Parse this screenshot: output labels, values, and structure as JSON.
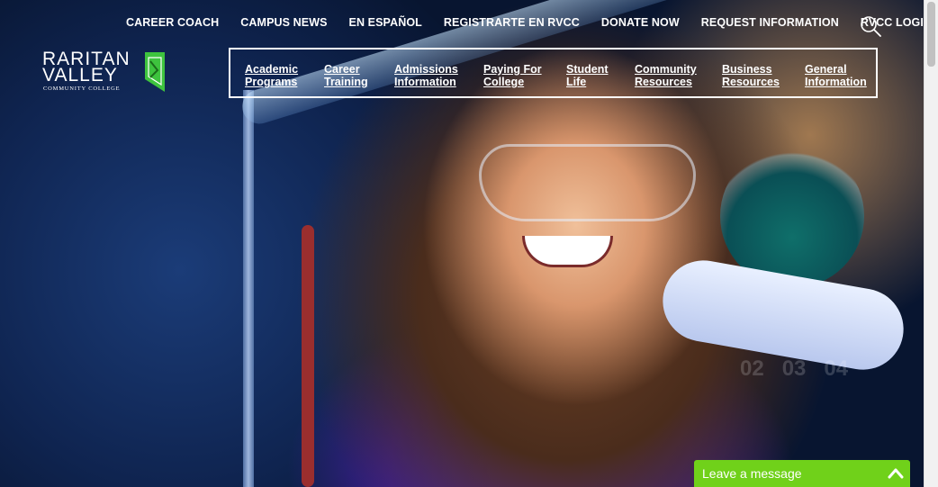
{
  "utility_links": [
    "CAREER COACH",
    "CAMPUS NEWS",
    "EN ESPAÑOL",
    "REGISTRARTE EN RVCC",
    "DONATE NOW",
    "REQUEST INFORMATION",
    "RVCC LOGIN"
  ],
  "logo": {
    "line1": "RARITAN",
    "line2": "VALLEY",
    "line3": "COMMUNITY COLLEGE"
  },
  "main_nav": [
    {
      "line1": "Academic",
      "line2": "Programs"
    },
    {
      "line1": "Career",
      "line2": "Training"
    },
    {
      "line1": "Admissions",
      "line2": "Information"
    },
    {
      "line1": "Paying For",
      "line2": "College"
    },
    {
      "line1": "Student",
      "line2": "Life"
    },
    {
      "line1": "Community",
      "line2": "Resources"
    },
    {
      "line1": "Business",
      "line2": "Resources"
    },
    {
      "line1": "General",
      "line2": "Information"
    }
  ],
  "slider": {
    "indicators": [
      "02",
      "03",
      "04"
    ]
  },
  "chat": {
    "label": "Leave a message"
  },
  "colors": {
    "chat_green": "#70d11a",
    "logo_green": "#3ec33e"
  },
  "icons": {
    "search": "search-icon",
    "chat_toggle": "chevron-up-icon"
  }
}
